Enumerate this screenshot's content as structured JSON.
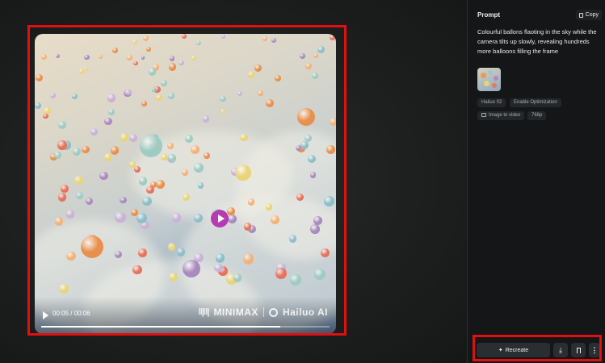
{
  "video": {
    "time": "00:05 / 00:06",
    "progress": 0.83,
    "watermark_brand_1": "MINIMAX",
    "watermark_brand_2": "Hailuo AI"
  },
  "panel": {
    "title": "Prompt",
    "copy_label": "Copy",
    "prompt": "Colourful ballons flaoting in the sky while the camera tilts up slowly, revealing hundreds more balloons filling the frame",
    "tags": {
      "model": "Hailuo 02",
      "optimization": "Enable Optimization",
      "mode": "Image to video",
      "resolution": "768p"
    }
  },
  "actions": {
    "recreate_label": "Recreate",
    "recreate_icon": "sparkle-icon",
    "download_icon": "download-icon",
    "bookmark_icon": "bookmark-icon",
    "more_icon": "more-vertical-icon"
  },
  "colors": {
    "highlight": "#e01010",
    "play_badge": "#b53ab3"
  }
}
